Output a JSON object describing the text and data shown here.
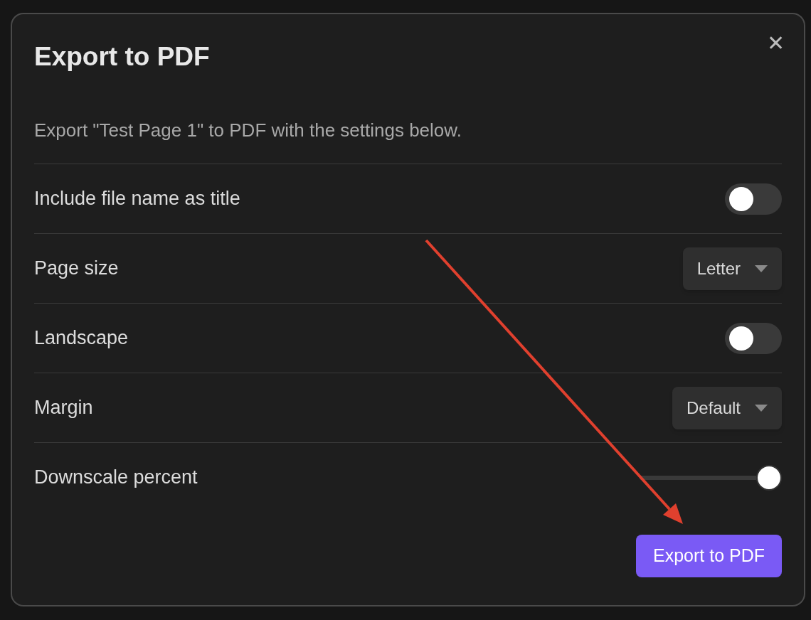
{
  "dialog": {
    "title": "Export to PDF",
    "close": "✕",
    "description": "Export \"Test Page 1\" to PDF with the settings below.",
    "settings": [
      {
        "kind": "toggle",
        "label": "Include file name as title",
        "on": false
      },
      {
        "kind": "dropdown",
        "label": "Page size",
        "value": "Letter"
      },
      {
        "kind": "toggle",
        "label": "Landscape",
        "on": false
      },
      {
        "kind": "dropdown",
        "label": "Margin",
        "value": "Default"
      },
      {
        "kind": "slider",
        "label": "Downscale percent",
        "level": 1
      }
    ],
    "primary_button": "Export to PDF"
  }
}
